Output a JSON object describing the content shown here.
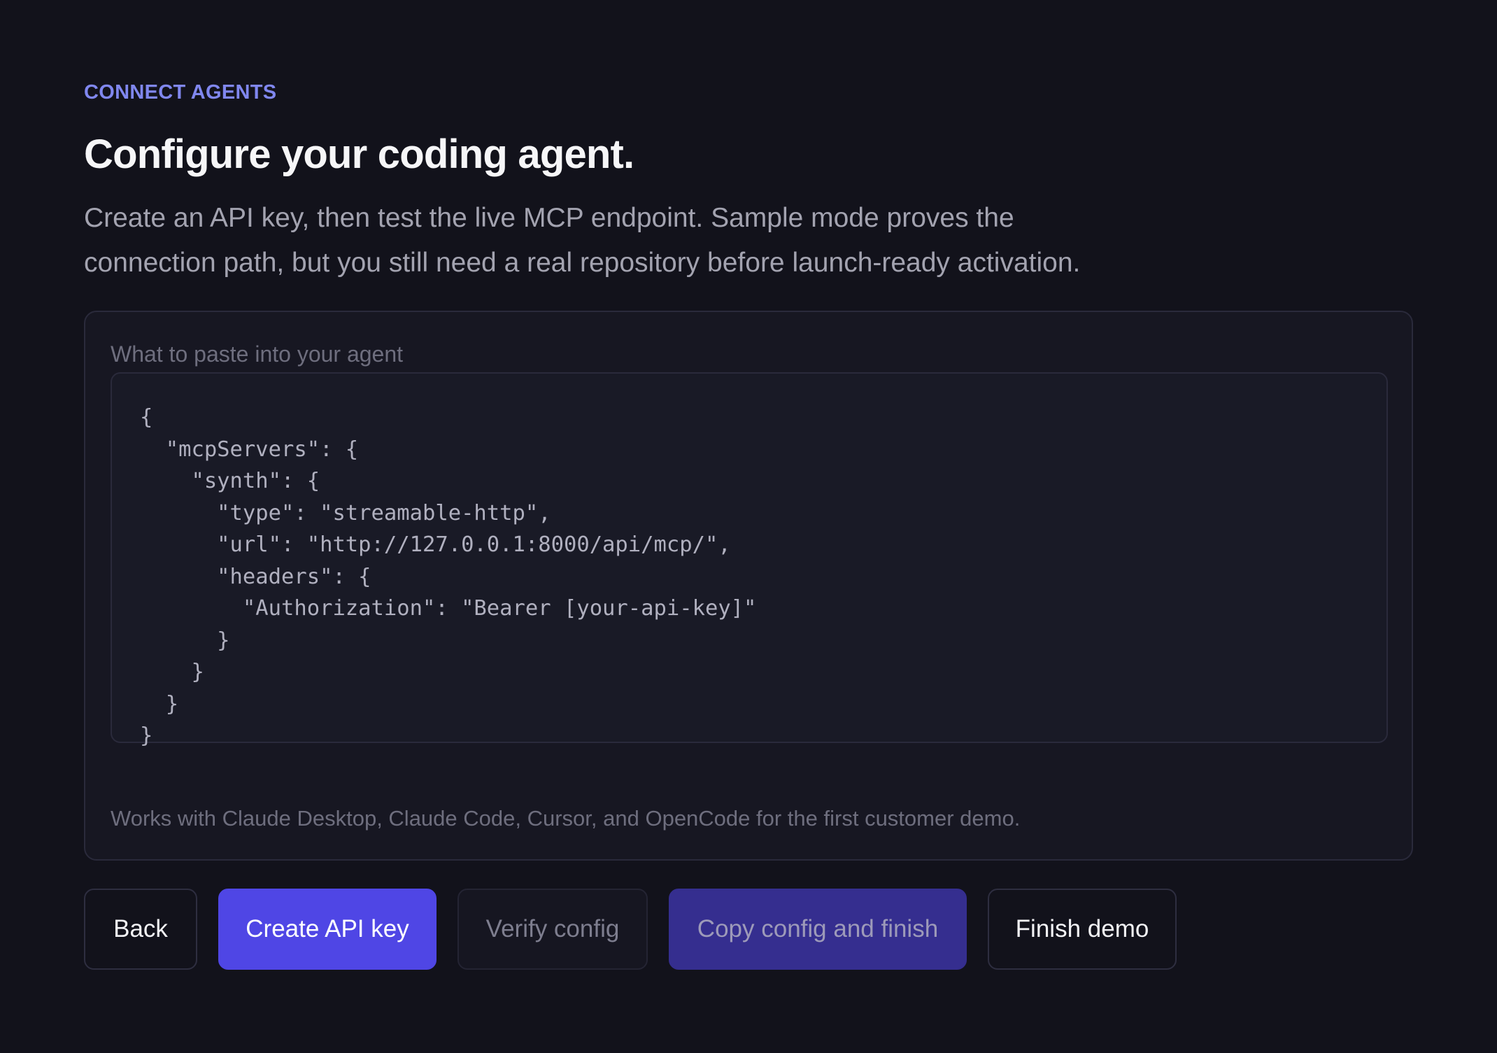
{
  "header": {
    "eyebrow": "CONNECT AGENTS",
    "title": "Configure your coding agent.",
    "subtitle_line1": "Create an API key, then test the live MCP endpoint. Sample mode proves the",
    "subtitle_line2": "connection path, but you still need a real repository before launch-ready activation."
  },
  "config_panel": {
    "label": "What to paste into your agent",
    "code": "{\n  \"mcpServers\": {\n    \"synth\": {\n      \"type\": \"streamable-http\",\n      \"url\": \"http://127.0.0.1:8000/api/mcp/\",\n      \"headers\": {\n        \"Authorization\": \"Bearer [your-api-key]\"\n      }\n    }\n  }\n}",
    "footnote": "Works with Claude Desktop, Claude Code, Cursor, and OpenCode for the first customer demo."
  },
  "actions": {
    "back": "Back",
    "create_api_key": "Create API key",
    "verify_config": "Verify config",
    "copy_and_finish": "Copy config and finish",
    "finish_demo": "Finish demo"
  },
  "colors": {
    "background": "#12121b",
    "accent": "#4f46e5",
    "eyebrow": "#8087ef",
    "panel": "#171722"
  }
}
